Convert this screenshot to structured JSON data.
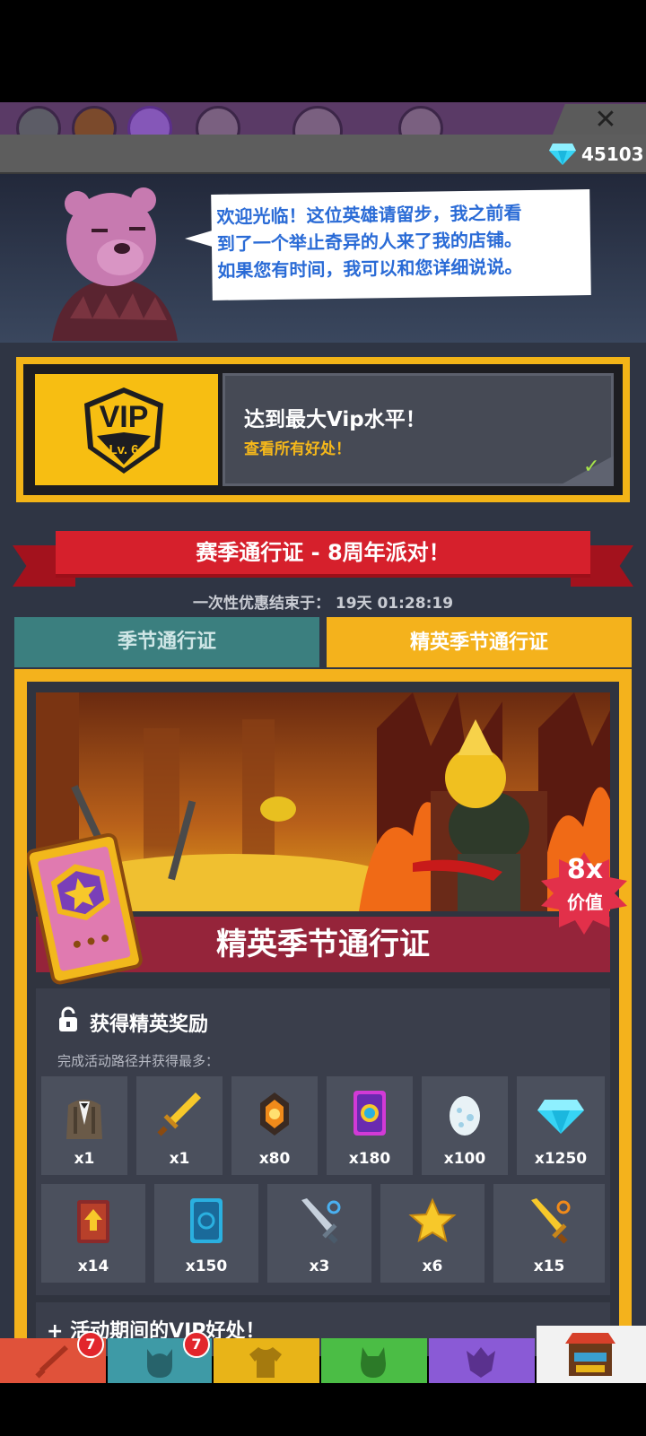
{
  "currency": {
    "gems": "45103",
    "gem_icon": "diamond-icon"
  },
  "dialog": {
    "speaker_icon": "bear-merchant",
    "lines": [
      "欢迎光临！这位英雄请留步，我之前看",
      "到了一个举止奇异的人来了我的店铺。",
      "如果您有时间，我可以和您详细说说。"
    ]
  },
  "vip": {
    "badge_title": "VIP",
    "badge_level": "Lv. 6",
    "title": "达到最大Vip水平！",
    "link": "查看所有好处！",
    "check": "✓"
  },
  "season": {
    "ribbon": "赛季通行证 - 8周年派对！",
    "offer_label": "一次性优惠结束于：",
    "offer_time": "19天 01:28:19",
    "tabs": [
      "季节通行证",
      "精英季节通行证"
    ],
    "banner_title": "精英季节通行证",
    "value_multiplier": "8x",
    "value_label": "价值"
  },
  "rewards": {
    "title": "获得精英奖励",
    "subtitle": "完成活动路径并获得最多：",
    "row1": [
      {
        "icon": "suit-costume-icon",
        "qty": "x1"
      },
      {
        "icon": "golden-sword-icon",
        "qty": "x1"
      },
      {
        "icon": "fire-stone-icon",
        "qty": "x80"
      },
      {
        "icon": "rainbow-card-icon",
        "qty": "x180"
      },
      {
        "icon": "egg-icon",
        "qty": "x100"
      },
      {
        "icon": "diamond-icon",
        "qty": "x1250"
      }
    ],
    "row2": [
      {
        "icon": "upgrade-book-icon",
        "qty": "x14"
      },
      {
        "icon": "blue-card-icon",
        "qty": "x150"
      },
      {
        "icon": "silver-sword-icon",
        "qty": "x3"
      },
      {
        "icon": "star-icon",
        "qty": "x6"
      },
      {
        "icon": "gold-sword-icon",
        "qty": "x15"
      }
    ]
  },
  "vip_bonus": {
    "label": "活动期间的VIP好处！"
  },
  "bottom_nav": [
    {
      "icon": "sword-icon",
      "color": "#e0523a",
      "badge": "7"
    },
    {
      "icon": "helmet-icon",
      "color": "#3e9aa6",
      "badge": "7"
    },
    {
      "icon": "shirt-icon",
      "color": "#e8b418",
      "badge": ""
    },
    {
      "icon": "pet-icon",
      "color": "#4bbd45",
      "badge": ""
    },
    {
      "icon": "guild-icon",
      "color": "#8a5ad6",
      "badge": ""
    },
    {
      "icon": "shop-icon",
      "color": "#f2f2f2",
      "badge": ""
    }
  ]
}
